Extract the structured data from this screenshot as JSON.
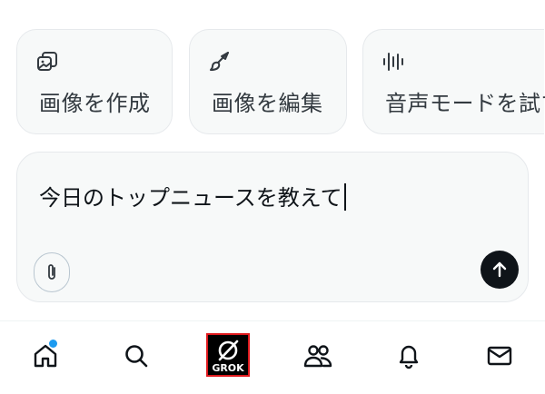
{
  "quick_actions": [
    {
      "label": "画像を作成",
      "icon": "image-stack-icon"
    },
    {
      "label": "画像を編集",
      "icon": "brush-icon"
    },
    {
      "label": "音声モードを試す",
      "icon": "waveform-icon"
    }
  ],
  "composer": {
    "text": "今日のトップニュースを教えて",
    "attach_icon": "paperclip-icon",
    "send_icon": "arrow-up-icon"
  },
  "nav": {
    "items": [
      {
        "name": "home",
        "icon": "home-icon",
        "badge": true
      },
      {
        "name": "search",
        "icon": "search-icon"
      },
      {
        "name": "grok",
        "icon": "grok-logo-icon",
        "label": "GROK",
        "highlight_color": "#e0191d"
      },
      {
        "name": "communities",
        "icon": "people-icon"
      },
      {
        "name": "notifications",
        "icon": "bell-icon"
      },
      {
        "name": "messages",
        "icon": "mail-icon"
      }
    ]
  },
  "colors": {
    "badge": "#1d9bf0",
    "send_bg": "#0f1419",
    "chip_bg": "#f7f9f9"
  }
}
